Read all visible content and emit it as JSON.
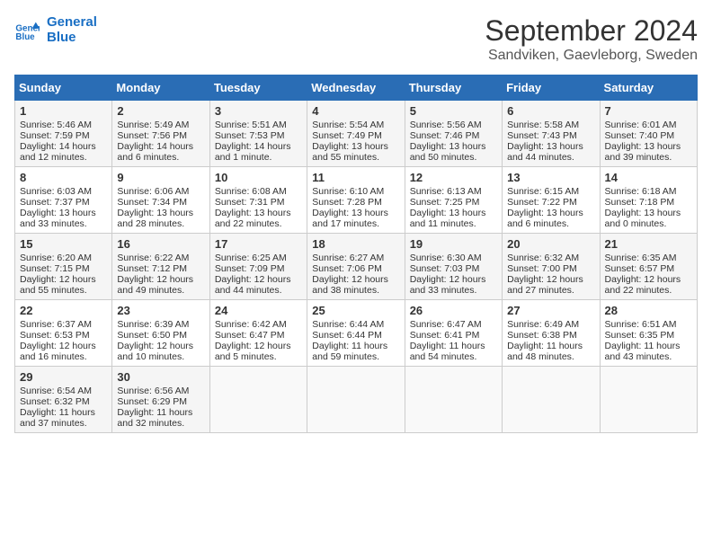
{
  "header": {
    "logo_line1": "General",
    "logo_line2": "Blue",
    "title": "September 2024",
    "subtitle": "Sandviken, Gaevleborg, Sweden"
  },
  "columns": [
    "Sunday",
    "Monday",
    "Tuesday",
    "Wednesday",
    "Thursday",
    "Friday",
    "Saturday"
  ],
  "weeks": [
    [
      {
        "day": "1",
        "lines": [
          "Sunrise: 5:46 AM",
          "Sunset: 7:59 PM",
          "Daylight: 14 hours",
          "and 12 minutes."
        ]
      },
      {
        "day": "2",
        "lines": [
          "Sunrise: 5:49 AM",
          "Sunset: 7:56 PM",
          "Daylight: 14 hours",
          "and 6 minutes."
        ]
      },
      {
        "day": "3",
        "lines": [
          "Sunrise: 5:51 AM",
          "Sunset: 7:53 PM",
          "Daylight: 14 hours",
          "and 1 minute."
        ]
      },
      {
        "day": "4",
        "lines": [
          "Sunrise: 5:54 AM",
          "Sunset: 7:49 PM",
          "Daylight: 13 hours",
          "and 55 minutes."
        ]
      },
      {
        "day": "5",
        "lines": [
          "Sunrise: 5:56 AM",
          "Sunset: 7:46 PM",
          "Daylight: 13 hours",
          "and 50 minutes."
        ]
      },
      {
        "day": "6",
        "lines": [
          "Sunrise: 5:58 AM",
          "Sunset: 7:43 PM",
          "Daylight: 13 hours",
          "and 44 minutes."
        ]
      },
      {
        "day": "7",
        "lines": [
          "Sunrise: 6:01 AM",
          "Sunset: 7:40 PM",
          "Daylight: 13 hours",
          "and 39 minutes."
        ]
      }
    ],
    [
      {
        "day": "8",
        "lines": [
          "Sunrise: 6:03 AM",
          "Sunset: 7:37 PM",
          "Daylight: 13 hours",
          "and 33 minutes."
        ]
      },
      {
        "day": "9",
        "lines": [
          "Sunrise: 6:06 AM",
          "Sunset: 7:34 PM",
          "Daylight: 13 hours",
          "and 28 minutes."
        ]
      },
      {
        "day": "10",
        "lines": [
          "Sunrise: 6:08 AM",
          "Sunset: 7:31 PM",
          "Daylight: 13 hours",
          "and 22 minutes."
        ]
      },
      {
        "day": "11",
        "lines": [
          "Sunrise: 6:10 AM",
          "Sunset: 7:28 PM",
          "Daylight: 13 hours",
          "and 17 minutes."
        ]
      },
      {
        "day": "12",
        "lines": [
          "Sunrise: 6:13 AM",
          "Sunset: 7:25 PM",
          "Daylight: 13 hours",
          "and 11 minutes."
        ]
      },
      {
        "day": "13",
        "lines": [
          "Sunrise: 6:15 AM",
          "Sunset: 7:22 PM",
          "Daylight: 13 hours",
          "and 6 minutes."
        ]
      },
      {
        "day": "14",
        "lines": [
          "Sunrise: 6:18 AM",
          "Sunset: 7:18 PM",
          "Daylight: 13 hours",
          "and 0 minutes."
        ]
      }
    ],
    [
      {
        "day": "15",
        "lines": [
          "Sunrise: 6:20 AM",
          "Sunset: 7:15 PM",
          "Daylight: 12 hours",
          "and 55 minutes."
        ]
      },
      {
        "day": "16",
        "lines": [
          "Sunrise: 6:22 AM",
          "Sunset: 7:12 PM",
          "Daylight: 12 hours",
          "and 49 minutes."
        ]
      },
      {
        "day": "17",
        "lines": [
          "Sunrise: 6:25 AM",
          "Sunset: 7:09 PM",
          "Daylight: 12 hours",
          "and 44 minutes."
        ]
      },
      {
        "day": "18",
        "lines": [
          "Sunrise: 6:27 AM",
          "Sunset: 7:06 PM",
          "Daylight: 12 hours",
          "and 38 minutes."
        ]
      },
      {
        "day": "19",
        "lines": [
          "Sunrise: 6:30 AM",
          "Sunset: 7:03 PM",
          "Daylight: 12 hours",
          "and 33 minutes."
        ]
      },
      {
        "day": "20",
        "lines": [
          "Sunrise: 6:32 AM",
          "Sunset: 7:00 PM",
          "Daylight: 12 hours",
          "and 27 minutes."
        ]
      },
      {
        "day": "21",
        "lines": [
          "Sunrise: 6:35 AM",
          "Sunset: 6:57 PM",
          "Daylight: 12 hours",
          "and 22 minutes."
        ]
      }
    ],
    [
      {
        "day": "22",
        "lines": [
          "Sunrise: 6:37 AM",
          "Sunset: 6:53 PM",
          "Daylight: 12 hours",
          "and 16 minutes."
        ]
      },
      {
        "day": "23",
        "lines": [
          "Sunrise: 6:39 AM",
          "Sunset: 6:50 PM",
          "Daylight: 12 hours",
          "and 10 minutes."
        ]
      },
      {
        "day": "24",
        "lines": [
          "Sunrise: 6:42 AM",
          "Sunset: 6:47 PM",
          "Daylight: 12 hours",
          "and 5 minutes."
        ]
      },
      {
        "day": "25",
        "lines": [
          "Sunrise: 6:44 AM",
          "Sunset: 6:44 PM",
          "Daylight: 11 hours",
          "and 59 minutes."
        ]
      },
      {
        "day": "26",
        "lines": [
          "Sunrise: 6:47 AM",
          "Sunset: 6:41 PM",
          "Daylight: 11 hours",
          "and 54 minutes."
        ]
      },
      {
        "day": "27",
        "lines": [
          "Sunrise: 6:49 AM",
          "Sunset: 6:38 PM",
          "Daylight: 11 hours",
          "and 48 minutes."
        ]
      },
      {
        "day": "28",
        "lines": [
          "Sunrise: 6:51 AM",
          "Sunset: 6:35 PM",
          "Daylight: 11 hours",
          "and 43 minutes."
        ]
      }
    ],
    [
      {
        "day": "29",
        "lines": [
          "Sunrise: 6:54 AM",
          "Sunset: 6:32 PM",
          "Daylight: 11 hours",
          "and 37 minutes."
        ]
      },
      {
        "day": "30",
        "lines": [
          "Sunrise: 6:56 AM",
          "Sunset: 6:29 PM",
          "Daylight: 11 hours",
          "and 32 minutes."
        ]
      },
      {
        "day": "",
        "lines": []
      },
      {
        "day": "",
        "lines": []
      },
      {
        "day": "",
        "lines": []
      },
      {
        "day": "",
        "lines": []
      },
      {
        "day": "",
        "lines": []
      }
    ]
  ]
}
